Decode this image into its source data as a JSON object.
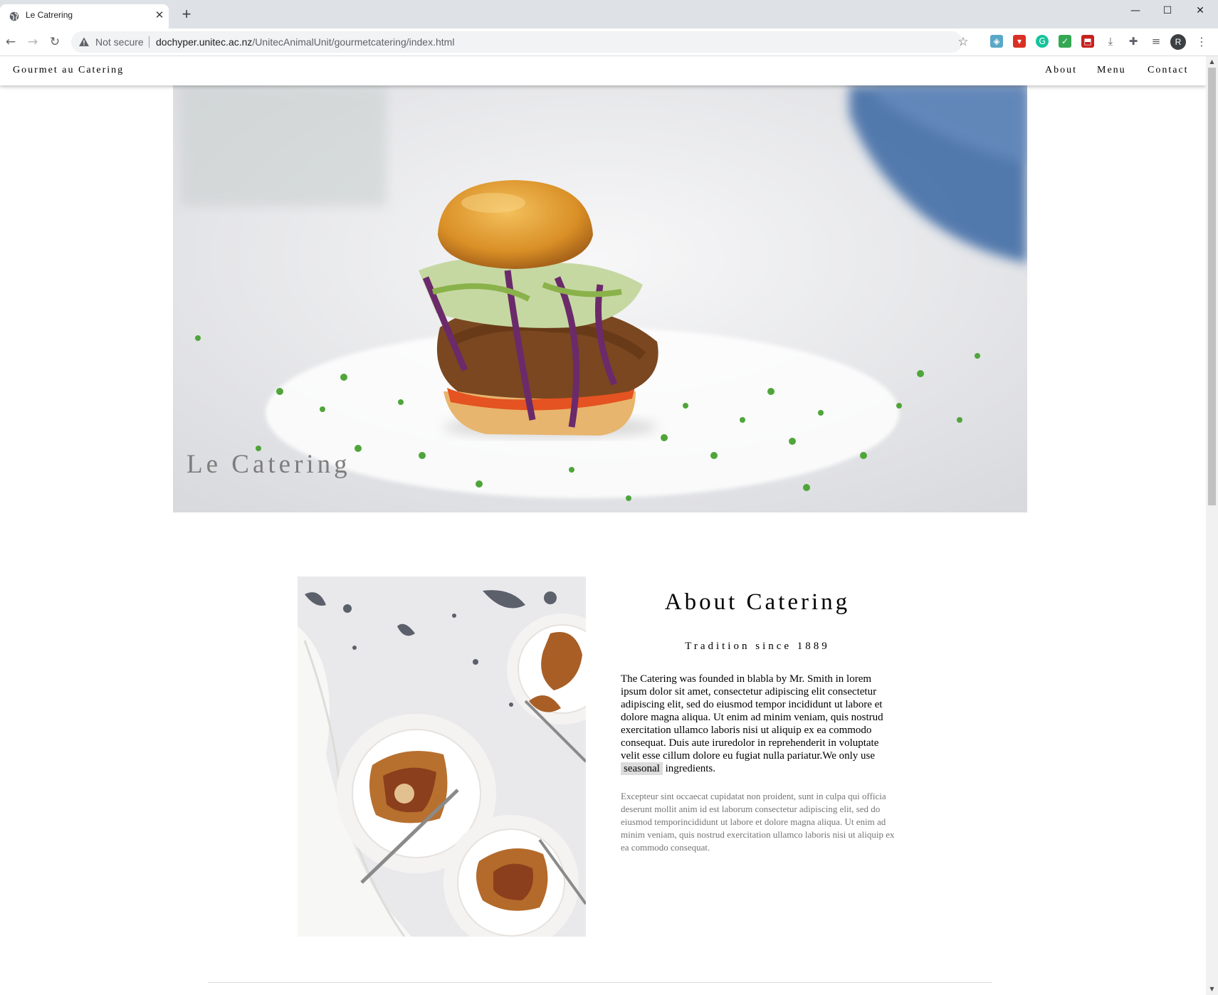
{
  "browser": {
    "tab_title": "Le Catrering",
    "new_tab_label": "+",
    "security_label": "Not secure",
    "url_host": "dochyper.unitec.ac.nz",
    "url_path": "/UnitecAnimalUnit/gourmetcatering/index.html",
    "profile_initial": "R",
    "icons": [
      "globe-icon",
      "close-icon",
      "back-icon",
      "forward-icon",
      "reload-icon",
      "warning-icon",
      "star-icon",
      "extensions-icon",
      "menu-icon"
    ]
  },
  "site": {
    "brand": "Gourmet au Catering",
    "nav": [
      "About",
      "Menu",
      "Contact"
    ]
  },
  "hero": {
    "title": "Le Catering"
  },
  "about": {
    "title": "About Catering",
    "subtitle": "Tradition since 1889",
    "paragraph_main": "The Catering was founded in blabla by Mr. Smith in lorem ipsum dolor sit amet, consectetur adipiscing elit consectetur adipiscing elit, sed do eiusmod tempor incididunt ut labore et dolore magna aliqua. Ut enim ad minim veniam, quis nostrud exercitation ullamco laboris nisi ut aliquip ex ea commodo consequat. Duis aute iruredolor in reprehenderit in voluptate velit esse cillum dolore eu fugiat nulla pariatur.We only use ",
    "highlight": "seasonal",
    "paragraph_end": " ingredients.",
    "paragraph_secondary": "Excepteur sint occaecat cupidatat non proident, sunt in culpa qui officia deserunt mollit anim id est laborum consectetur adipiscing elit, sed do eiusmod temporincididunt ut labore et dolore magna aliqua. Ut enim ad minim veniam, quis nostrud exercitation ullamco laboris nisi ut aliquip ex ea commodo consequat."
  },
  "colors": {
    "chrome_bg": "#dee1e6",
    "omnibox_bg": "#f1f3f4",
    "hero_title": "#7d7d7d",
    "muted_text": "#757575",
    "highlight_bg": "#dcdcdc"
  }
}
